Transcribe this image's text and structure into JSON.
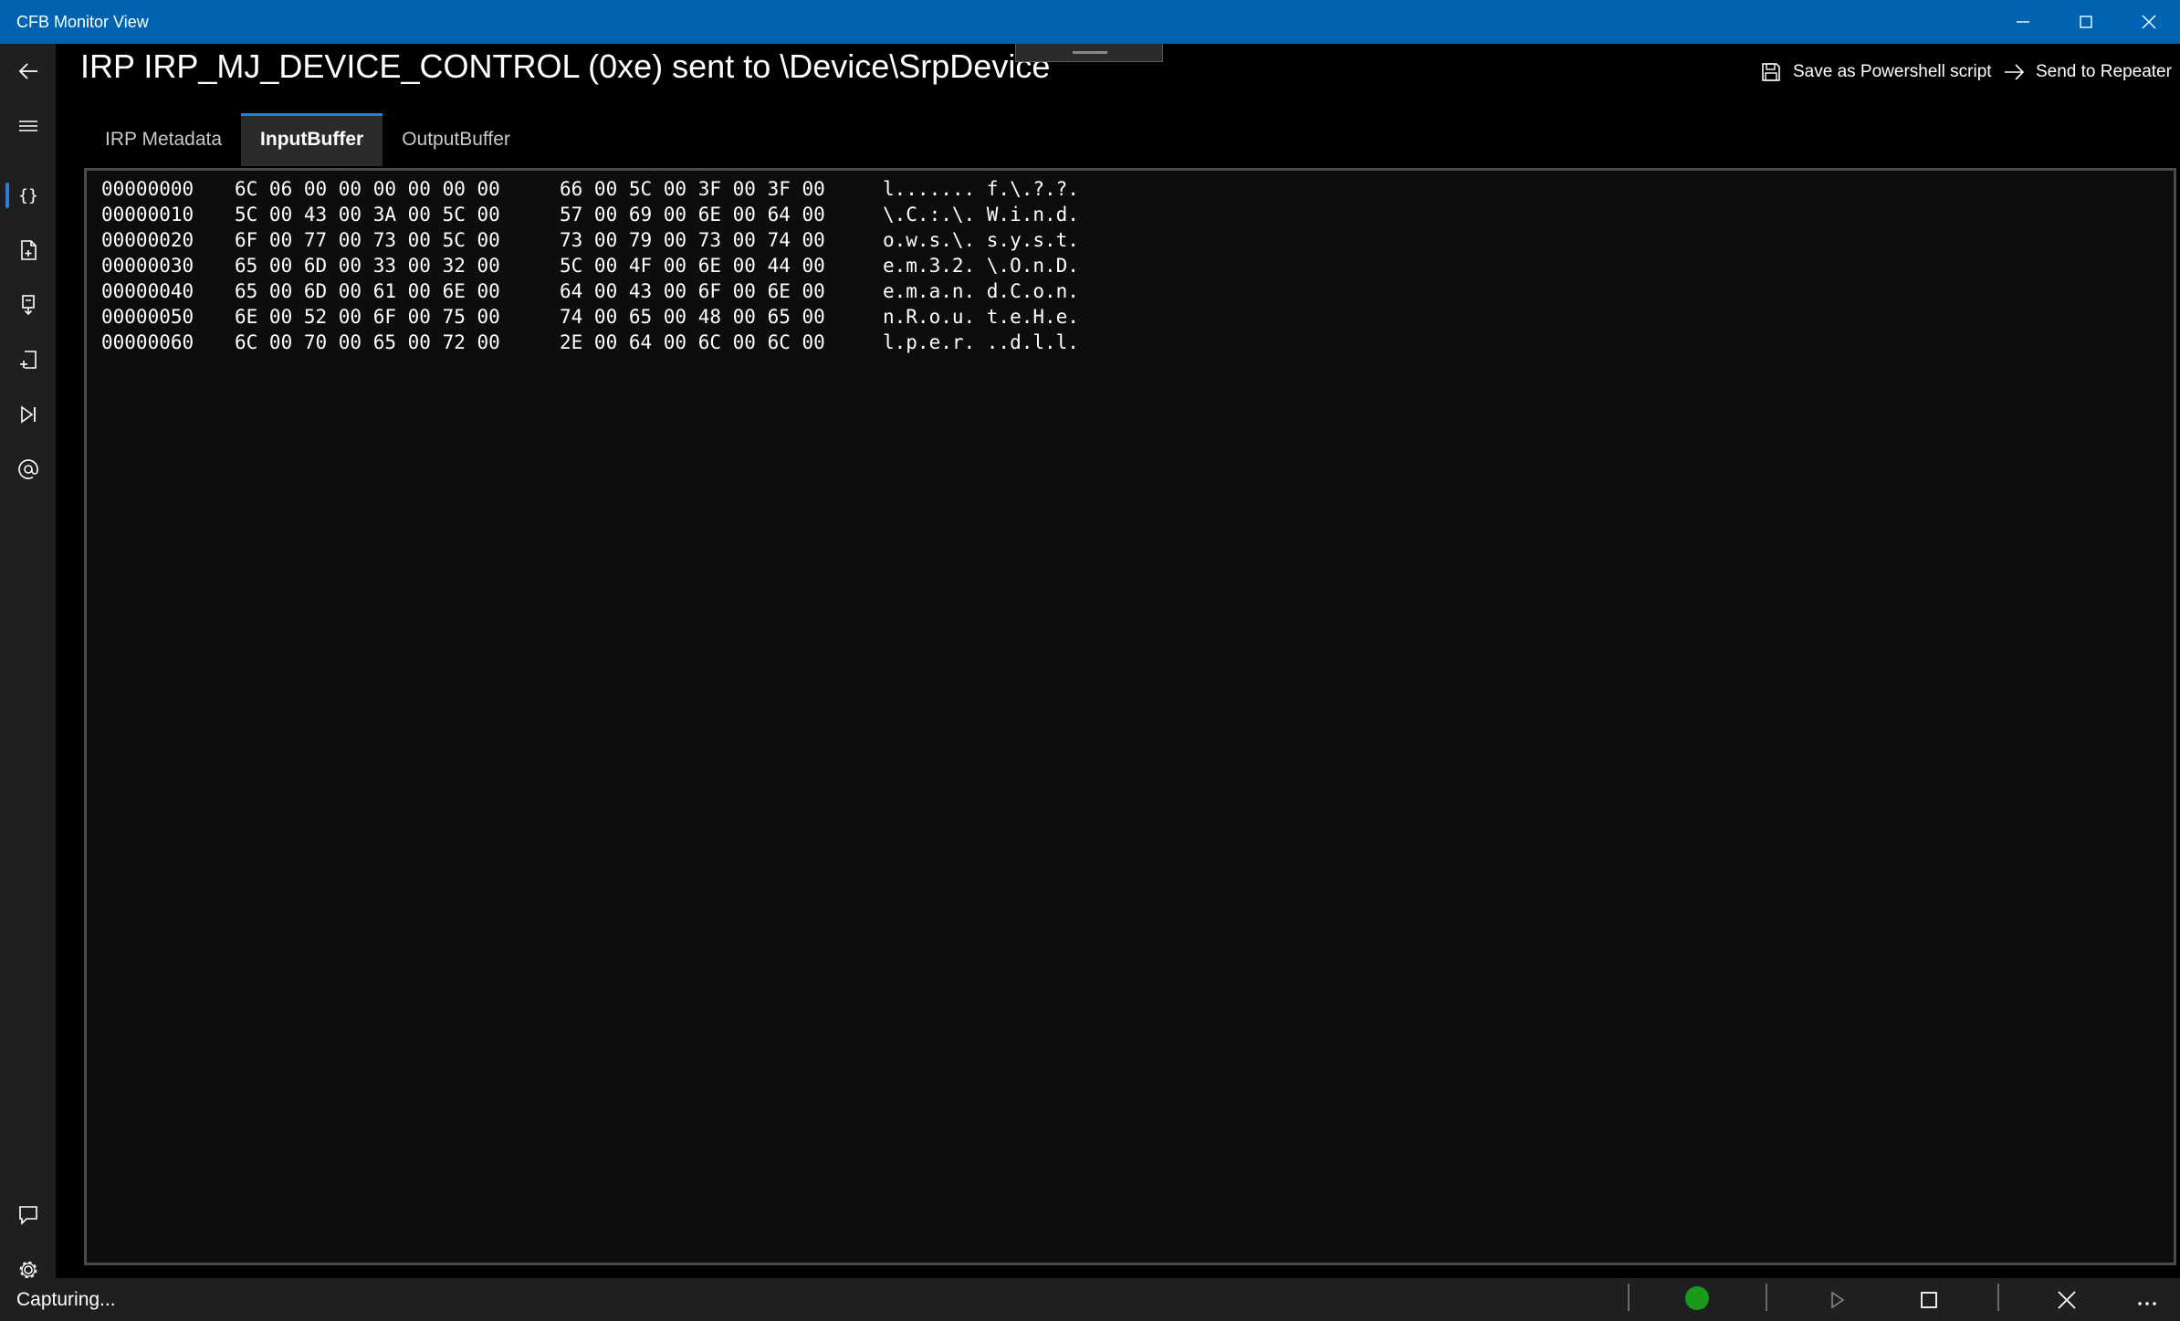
{
  "window": {
    "title": "CFB Monitor View",
    "minimize_icon": "minimize-icon",
    "maximize_icon": "maximize-icon",
    "close_icon": "close-icon"
  },
  "nav": {
    "items": [
      {
        "name": "back",
        "icon": "back-arrow-icon"
      },
      {
        "name": "menu",
        "icon": "hamburger-icon"
      },
      {
        "name": "irp-view",
        "icon": "braces-icon",
        "selected": true
      },
      {
        "name": "document",
        "icon": "document-icon"
      },
      {
        "name": "save",
        "icon": "save-device-icon"
      },
      {
        "name": "export",
        "icon": "export-icon"
      },
      {
        "name": "skip",
        "icon": "skip-forward-icon"
      },
      {
        "name": "at",
        "icon": "at-icon"
      },
      {
        "name": "feedback",
        "icon": "chat-icon"
      },
      {
        "name": "settings",
        "icon": "gear-icon"
      }
    ]
  },
  "header": {
    "title": "IRP IRP_MJ_DEVICE_CONTROL (0xe) sent to \\Device\\SrpDevice",
    "save_label": "Save as Powershell script",
    "send_label": "Send to Repeater"
  },
  "tabs": [
    {
      "label": "IRP Metadata",
      "active": false
    },
    {
      "label": "InputBuffer",
      "active": true
    },
    {
      "label": "OutputBuffer",
      "active": false
    }
  ],
  "hexdump": {
    "rows": [
      {
        "offset": "00000000",
        "bytes1": "6C 06 00 00 00 00 00 00",
        "bytes2": "66 00 5C 00 3F 00 3F 00",
        "ascii": "l....... f.\\.?.?."
      },
      {
        "offset": "00000010",
        "bytes1": "5C 00 43 00 3A 00 5C 00",
        "bytes2": "57 00 69 00 6E 00 64 00",
        "ascii": "\\.C.:.\\. W.i.n.d."
      },
      {
        "offset": "00000020",
        "bytes1": "6F 00 77 00 73 00 5C 00",
        "bytes2": "73 00 79 00 73 00 74 00",
        "ascii": "o.w.s.\\. s.y.s.t."
      },
      {
        "offset": "00000030",
        "bytes1": "65 00 6D 00 33 00 32 00",
        "bytes2": "5C 00 4F 00 6E 00 44 00",
        "ascii": "e.m.3.2. \\.O.n.D."
      },
      {
        "offset": "00000040",
        "bytes1": "65 00 6D 00 61 00 6E 00",
        "bytes2": "64 00 43 00 6F 00 6E 00",
        "ascii": "e.m.a.n. d.C.o.n."
      },
      {
        "offset": "00000050",
        "bytes1": "6E 00 52 00 6F 00 75 00",
        "bytes2": "74 00 65 00 48 00 65 00",
        "ascii": "n.R.o.u. t.e.H.e."
      },
      {
        "offset": "00000060",
        "bytes1": "6C 00 70 00 65 00 72 00",
        "bytes2": "2E 00 64 00 6C 00 6C 00",
        "ascii": "l.p.e.r. ..d.l.l."
      }
    ]
  },
  "status": {
    "text": "Capturing...",
    "indicator_color": "#1a9a1a",
    "play_icon": "play-icon",
    "stop_icon": "stop-icon",
    "clear_icon": "close-icon",
    "more_icon": "more-icon"
  },
  "colors": {
    "titlebar": "#0063b1",
    "accent": "#2d7cd6"
  }
}
